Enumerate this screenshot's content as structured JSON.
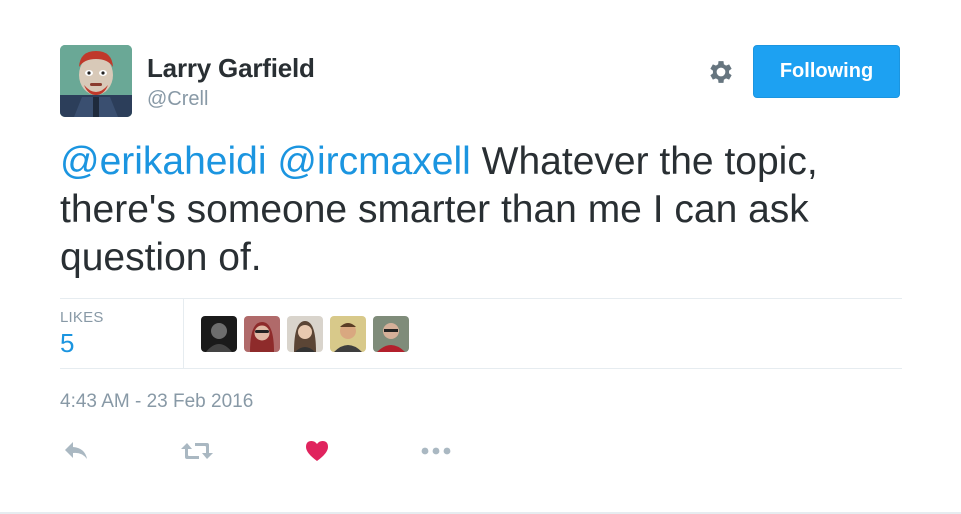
{
  "tweet": {
    "author": {
      "fullname": "Larry Garfield",
      "username": "@Crell",
      "avatar_icon": "avatar-image"
    },
    "follow_button_label": "Following",
    "settings_icon": "gear-icon",
    "text": {
      "mention_1": "@erikaheidi",
      "mention_2": "@ircmaxell",
      "body": " Whatever the topic, there's someone smarter than me I can ask question of."
    },
    "stats": {
      "likes_label": "LIKES",
      "likes_count": "5",
      "likers": [
        "liker-avatar-1",
        "liker-avatar-2",
        "liker-avatar-3",
        "liker-avatar-4",
        "liker-avatar-5"
      ]
    },
    "timestamp": "4:43 AM - 23 Feb 2016",
    "actions": [
      "reply-icon",
      "retweet-icon",
      "heart-icon",
      "more-icon"
    ]
  },
  "colors": {
    "accent": "#1da1f2",
    "link": "#1b95e0",
    "heart": "#e0245e",
    "muted": "#8899a6",
    "text": "#292f33"
  }
}
